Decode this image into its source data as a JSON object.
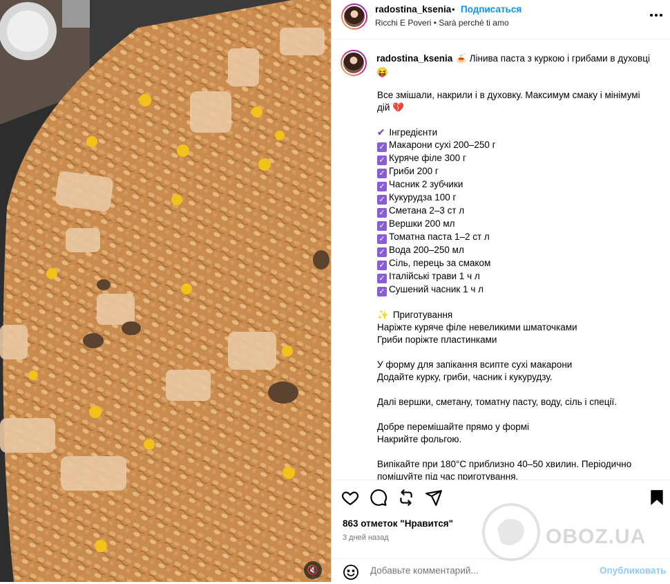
{
  "header": {
    "username": "radostina_ksenia",
    "separator": "•",
    "follow_label": "Подписаться",
    "music_artist": "Ricchi E Poveri",
    "music_separator": "•",
    "music_track": "Sarà perché ti amo",
    "more_icon": "more-horizontal-icon"
  },
  "caption": {
    "username": "radostina_ksenia",
    "title": "🍝 Лінива паста з куркою і грибами в духовці 😝",
    "lines": [
      {
        "prefix": "",
        "text": "Все змішали, накрили і в духовку. Максимум смаку і мінімумі"
      },
      {
        "prefix": "",
        "text": "дій 💔"
      },
      {
        "prefix": "",
        "text": ""
      },
      {
        "prefix": "tick",
        "text": "Інгредієнти"
      },
      {
        "prefix": "check",
        "text": "Макарони сухі 200–250 г"
      },
      {
        "prefix": "check",
        "text": "Куряче філе 300 г"
      },
      {
        "prefix": "check",
        "text": "Гриби 200 г"
      },
      {
        "prefix": "check",
        "text": "Часник 2 зубчики"
      },
      {
        "prefix": "check",
        "text": "Кукурудза 100 г"
      },
      {
        "prefix": "check",
        "text": "Сметана 2–3 ст л"
      },
      {
        "prefix": "check",
        "text": "Вершки 200 мл"
      },
      {
        "prefix": "check",
        "text": "Томатна паста 1–2 ст л"
      },
      {
        "prefix": "check",
        "text": "Вода 200–250 мл"
      },
      {
        "prefix": "check",
        "text": "Сіль, перець за смаком"
      },
      {
        "prefix": "check",
        "text": "Італійські трави 1 ч л"
      },
      {
        "prefix": "check",
        "text": "Сушений часник 1 ч л"
      },
      {
        "prefix": "",
        "text": ""
      },
      {
        "prefix": "spark",
        "text": "Приготування"
      },
      {
        "prefix": "",
        "text": "Наріжте куряче філе невеликими шматочками"
      },
      {
        "prefix": "",
        "text": "Гриби поріжте пластинками"
      },
      {
        "prefix": "",
        "text": ""
      },
      {
        "prefix": "",
        "text": "У форму для запікання всипте сухі макарони"
      },
      {
        "prefix": "",
        "text": "Додайте курку, гриби, часник і кукурудзу."
      },
      {
        "prefix": "",
        "text": ""
      },
      {
        "prefix": "",
        "text": "Далі вершки, сметану, томатну пасту, воду, сіль і спеції."
      },
      {
        "prefix": "",
        "text": ""
      },
      {
        "prefix": "",
        "text": "Добре перемішайте прямо у формі"
      },
      {
        "prefix": "",
        "text": "Накрийте фольгою."
      },
      {
        "prefix": "",
        "text": ""
      },
      {
        "prefix": "",
        "text": "Випікайте при 180°C приблизно 40–50 хвилин. Періодично"
      },
      {
        "prefix": "",
        "text": "помішуйте під час приготування."
      }
    ]
  },
  "footer": {
    "likes": "863 отметок \"Нравится\"",
    "time": "3 дней назад",
    "comment_placeholder": "Добавьте комментарий...",
    "publish_label": "Опубликовать"
  },
  "watermark": {
    "text": "OBOZ.UA"
  },
  "colors": {
    "follow": "#0095f6",
    "check": "#8a5cd6",
    "publish": "#8fc9f9"
  }
}
